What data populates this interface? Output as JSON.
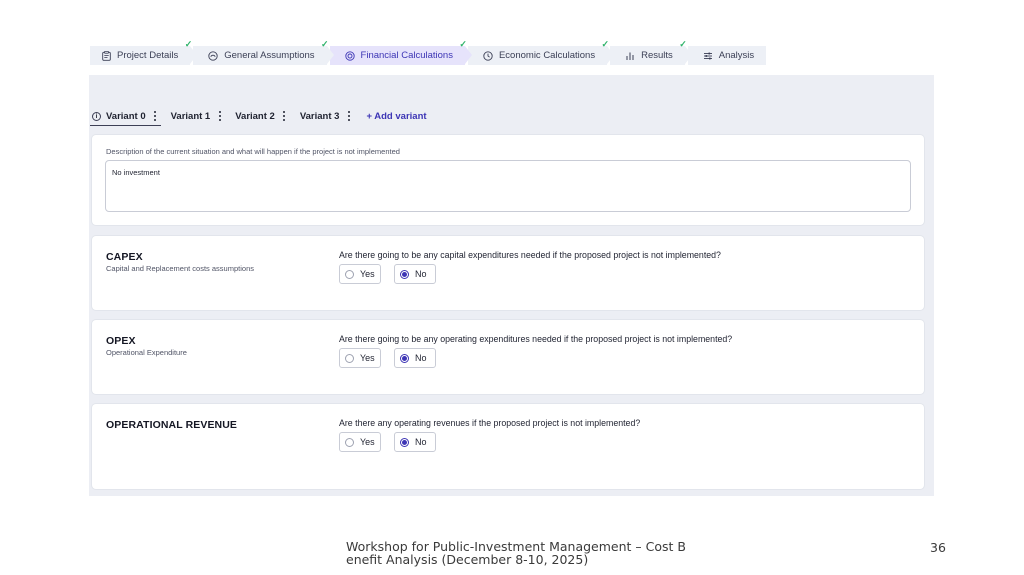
{
  "stepper": {
    "steps": [
      {
        "label": "Project Details",
        "icon": "clipboard-icon",
        "completed": true,
        "active": false
      },
      {
        "label": "General Assumptions",
        "icon": "gauge-icon",
        "completed": true,
        "active": false
      },
      {
        "label": "Financial Calculations",
        "icon": "coin-icon",
        "completed": true,
        "active": true
      },
      {
        "label": "Economic Calculations",
        "icon": "clock-icon",
        "completed": true,
        "active": false
      },
      {
        "label": "Results",
        "icon": "bar-chart-icon",
        "completed": true,
        "active": false
      },
      {
        "label": "Analysis",
        "icon": "sliders-icon",
        "completed": false,
        "active": false
      }
    ]
  },
  "variants": {
    "tabs": [
      {
        "label": "Variant 0",
        "active": true
      },
      {
        "label": "Variant 1",
        "active": false
      },
      {
        "label": "Variant 2",
        "active": false
      },
      {
        "label": "Variant 3",
        "active": false
      }
    ],
    "add_label": "+ Add variant"
  },
  "description": {
    "label": "Description of the current situation and what will happen if the project is not implemented",
    "value": "No investment"
  },
  "sections": [
    {
      "title": "CAPEX",
      "subtitle": "Capital and Replacement costs assumptions",
      "question": "Are there going to be any capital expenditures needed if the proposed project is not implemented?",
      "yes_label": "Yes",
      "no_label": "No",
      "selected": "No"
    },
    {
      "title": "OPEX",
      "subtitle": "Operational Expenditure",
      "question": "Are there going to be any operating expenditures needed if the proposed project is not implemented?",
      "yes_label": "Yes",
      "no_label": "No",
      "selected": "No"
    },
    {
      "title": "OPERATIONAL REVENUE",
      "subtitle": "",
      "question": "Are there any operating revenues if the proposed project is not implemented?",
      "yes_label": "Yes",
      "no_label": "No",
      "selected": "No"
    }
  ],
  "footer": {
    "text": "Workshop for Public-Investment Management – Cost B enefit Analysis (December 8-10, 2025)",
    "page_number": "36"
  },
  "colors": {
    "accent": "#3d35b5",
    "check": "#2fb36a",
    "panel_bg": "#eceef4"
  }
}
